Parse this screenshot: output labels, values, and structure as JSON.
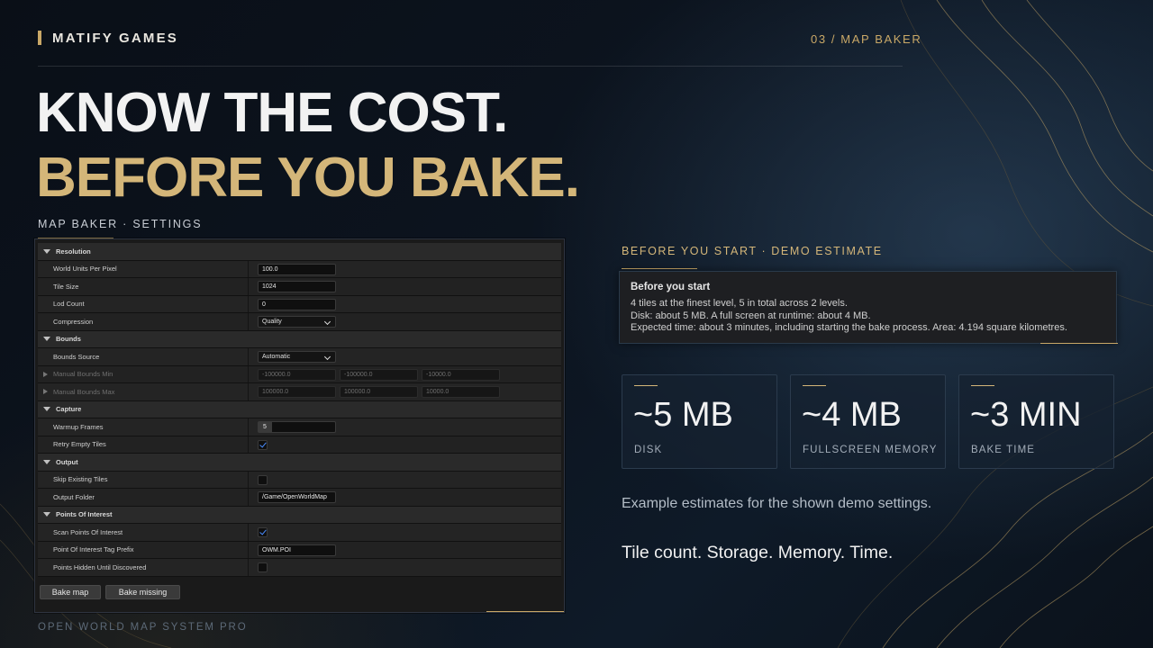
{
  "header": {
    "brand": "MATIFY GAMES",
    "section": "03 / MAP BAKER"
  },
  "headline": {
    "line1": "KNOW THE COST.",
    "line2": "BEFORE YOU BAKE."
  },
  "settings": {
    "caption": "MAP BAKER · SETTINGS",
    "categories": {
      "resolution": "Resolution",
      "bounds": "Bounds",
      "capture": "Capture",
      "output": "Output",
      "poi": "Points Of Interest"
    },
    "props": {
      "world_units_label": "World Units Per Pixel",
      "world_units_value": "100.0",
      "tile_size_label": "Tile Size",
      "tile_size_value": "1024",
      "lod_count_label": "Lod Count",
      "lod_count_value": "0",
      "compression_label": "Compression",
      "compression_value": "Quality",
      "bounds_source_label": "Bounds Source",
      "bounds_source_value": "Automatic",
      "bounds_min_label": "Manual Bounds Min",
      "bounds_min_x": "-100000.0",
      "bounds_min_y": "-100000.0",
      "bounds_min_z": "-10000.0",
      "bounds_max_label": "Manual Bounds Max",
      "bounds_max_x": "100000.0",
      "bounds_max_y": "100000.0",
      "bounds_max_z": "10000.0",
      "warmup_label": "Warmup Frames",
      "warmup_value": "5",
      "warmup_fraction": 0.18,
      "retry_label": "Retry Empty Tiles",
      "retry_checked": true,
      "skip_label": "Skip Existing Tiles",
      "skip_checked": false,
      "output_folder_label": "Output Folder",
      "output_folder_value": "/Game/OpenWorldMap",
      "scan_poi_label": "Scan Points Of Interest",
      "scan_poi_checked": true,
      "poi_prefix_label": "Point Of Interest Tag Prefix",
      "poi_prefix_value": "OWM.POI",
      "poi_hidden_label": "Points Hidden Until Discovered",
      "poi_hidden_checked": false
    },
    "buttons": {
      "bake_map": "Bake map",
      "bake_missing": "Bake missing"
    }
  },
  "estimate": {
    "caption": "BEFORE YOU START · DEMO ESTIMATE",
    "title": "Before you start",
    "line1": "4 tiles at the finest level, 5 in total across 2 levels.",
    "line2": "Disk: about 5 MB.  A full screen at runtime: about 4 MB.",
    "line3": "Expected time: about 3 minutes, including starting the bake process.  Area: 4.194 square kilometres."
  },
  "cards": [
    {
      "value": "~5 MB",
      "label": "DISK"
    },
    {
      "value": "~4 MB",
      "label": "FULLSCREEN MEMORY"
    },
    {
      "value": "~3 MIN",
      "label": "BAKE TIME"
    }
  ],
  "note": "Example estimates for the shown demo settings.",
  "tagline": "Tile count. Storage. Memory. Time.",
  "footer": "OPEN WORLD MAP SYSTEM PRO",
  "colors": {
    "accent_gold": "#d4b679",
    "background": "#0c141f",
    "checkbox_blue": "#4a8cff"
  }
}
